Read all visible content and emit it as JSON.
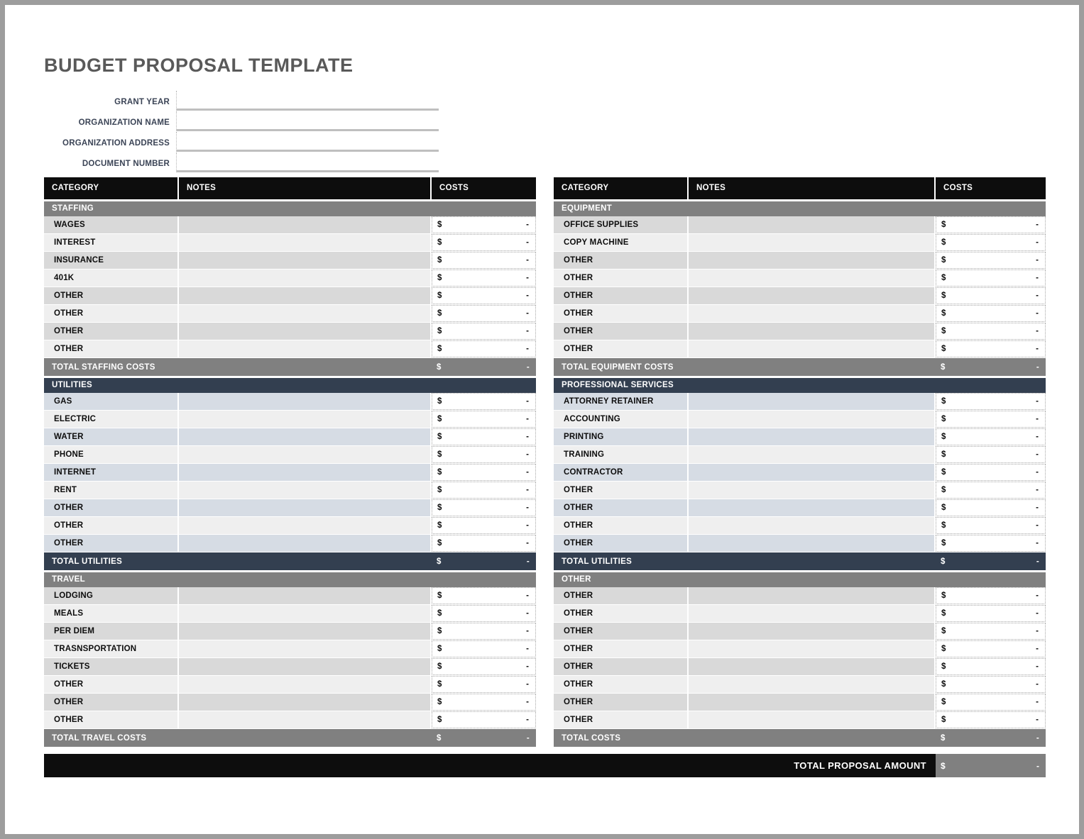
{
  "document": {
    "title": "BUDGET PROPOSAL TEMPLATE"
  },
  "form": {
    "fields": [
      {
        "label": "GRANT YEAR",
        "value": "",
        "placeholder": ""
      },
      {
        "label": "ORGANIZATION NAME",
        "value": "",
        "placeholder": ""
      },
      {
        "label": "ORGANIZATION ADDRESS",
        "value": "",
        "placeholder": ""
      },
      {
        "label": "DOCUMENT NUMBER",
        "value": "",
        "placeholder": ""
      }
    ]
  },
  "columns": {
    "category": "CATEGORY",
    "notes": "NOTES",
    "costs": "COSTS"
  },
  "currency_symbol": "$",
  "empty_amount": "-",
  "colors": {
    "header_black": "#0d0d0d",
    "section_gray": "#808080",
    "section_navy": "#333f50",
    "row_gray_odd": "#d9d9d9",
    "row_gray_even": "#efefef",
    "row_navy_odd": "#d6dce4",
    "row_navy_even": "#efefef",
    "title_text": "#595959",
    "label_text": "#3b4456",
    "page_frame": "#9d9d9d"
  },
  "tables": {
    "left": {
      "header": {
        "category": "CATEGORY",
        "notes": "NOTES",
        "costs": "COSTS"
      },
      "sections": [
        {
          "name": "STAFFING",
          "palette": "gray",
          "rows": [
            {
              "category": "WAGES",
              "notes": "",
              "cost": "-"
            },
            {
              "category": "INTEREST",
              "notes": "",
              "cost": "-"
            },
            {
              "category": "INSURANCE",
              "notes": "",
              "cost": "-"
            },
            {
              "category": "401K",
              "notes": "",
              "cost": "-"
            },
            {
              "category": "OTHER",
              "notes": "",
              "cost": "-"
            },
            {
              "category": "OTHER",
              "notes": "",
              "cost": "-"
            },
            {
              "category": "OTHER",
              "notes": "",
              "cost": "-"
            },
            {
              "category": "OTHER",
              "notes": "",
              "cost": "-"
            }
          ],
          "total": {
            "label": "TOTAL STAFFING COSTS",
            "cost": "-"
          }
        },
        {
          "name": "UTILITIES",
          "palette": "navy",
          "rows": [
            {
              "category": "GAS",
              "notes": "",
              "cost": "-"
            },
            {
              "category": "ELECTRIC",
              "notes": "",
              "cost": "-"
            },
            {
              "category": "WATER",
              "notes": "",
              "cost": "-"
            },
            {
              "category": "PHONE",
              "notes": "",
              "cost": "-"
            },
            {
              "category": "INTERNET",
              "notes": "",
              "cost": "-"
            },
            {
              "category": "RENT",
              "notes": "",
              "cost": "-"
            },
            {
              "category": "OTHER",
              "notes": "",
              "cost": "-"
            },
            {
              "category": "OTHER",
              "notes": "",
              "cost": "-"
            },
            {
              "category": "OTHER",
              "notes": "",
              "cost": "-"
            }
          ],
          "total": {
            "label": "TOTAL UTILITIES",
            "cost": "-"
          }
        },
        {
          "name": "TRAVEL",
          "palette": "gray",
          "rows": [
            {
              "category": "LODGING",
              "notes": "",
              "cost": "-"
            },
            {
              "category": "MEALS",
              "notes": "",
              "cost": "-"
            },
            {
              "category": "PER DIEM",
              "notes": "",
              "cost": "-"
            },
            {
              "category": "TRASNSPORTATION",
              "notes": "",
              "cost": "-"
            },
            {
              "category": "TICKETS",
              "notes": "",
              "cost": "-"
            },
            {
              "category": "OTHER",
              "notes": "",
              "cost": "-"
            },
            {
              "category": "OTHER",
              "notes": "",
              "cost": "-"
            },
            {
              "category": "OTHER",
              "notes": "",
              "cost": "-"
            }
          ],
          "total": {
            "label": "TOTAL TRAVEL COSTS",
            "cost": "-"
          }
        }
      ]
    },
    "right": {
      "header": {
        "category": "CATEGORY",
        "notes": "NOTES",
        "costs": "COSTS"
      },
      "sections": [
        {
          "name": "EQUIPMENT",
          "palette": "gray",
          "rows": [
            {
              "category": "OFFICE SUPPLIES",
              "notes": "",
              "cost": "-"
            },
            {
              "category": "COPY MACHINE",
              "notes": "",
              "cost": "-"
            },
            {
              "category": "OTHER",
              "notes": "",
              "cost": "-"
            },
            {
              "category": "OTHER",
              "notes": "",
              "cost": "-"
            },
            {
              "category": "OTHER",
              "notes": "",
              "cost": "-"
            },
            {
              "category": "OTHER",
              "notes": "",
              "cost": "-"
            },
            {
              "category": "OTHER",
              "notes": "",
              "cost": "-"
            },
            {
              "category": "OTHER",
              "notes": "",
              "cost": "-"
            }
          ],
          "total": {
            "label": "TOTAL EQUIPMENT COSTS",
            "cost": "-"
          }
        },
        {
          "name": "PROFESSIONAL SERVICES",
          "palette": "navy",
          "rows": [
            {
              "category": "ATTORNEY RETAINER",
              "notes": "",
              "cost": "-"
            },
            {
              "category": "ACCOUNTING",
              "notes": "",
              "cost": "-"
            },
            {
              "category": "PRINTING",
              "notes": "",
              "cost": "-"
            },
            {
              "category": "TRAINING",
              "notes": "",
              "cost": "-"
            },
            {
              "category": "CONTRACTOR",
              "notes": "",
              "cost": "-"
            },
            {
              "category": "OTHER",
              "notes": "",
              "cost": "-"
            },
            {
              "category": "OTHER",
              "notes": "",
              "cost": "-"
            },
            {
              "category": "OTHER",
              "notes": "",
              "cost": "-"
            },
            {
              "category": "OTHER",
              "notes": "",
              "cost": "-"
            }
          ],
          "total": {
            "label": "TOTAL UTILITIES",
            "cost": "-"
          }
        },
        {
          "name": "OTHER",
          "palette": "gray",
          "rows": [
            {
              "category": "OTHER",
              "notes": "",
              "cost": "-"
            },
            {
              "category": "OTHER",
              "notes": "",
              "cost": "-"
            },
            {
              "category": "OTHER",
              "notes": "",
              "cost": "-"
            },
            {
              "category": "OTHER",
              "notes": "",
              "cost": "-"
            },
            {
              "category": "OTHER",
              "notes": "",
              "cost": "-"
            },
            {
              "category": "OTHER",
              "notes": "",
              "cost": "-"
            },
            {
              "category": "OTHER",
              "notes": "",
              "cost": "-"
            },
            {
              "category": "OTHER",
              "notes": "",
              "cost": "-"
            }
          ],
          "total": {
            "label": "TOTAL COSTS",
            "cost": "-"
          }
        }
      ]
    }
  },
  "grand_total": {
    "label": "TOTAL PROPOSAL AMOUNT",
    "cost": "-"
  }
}
